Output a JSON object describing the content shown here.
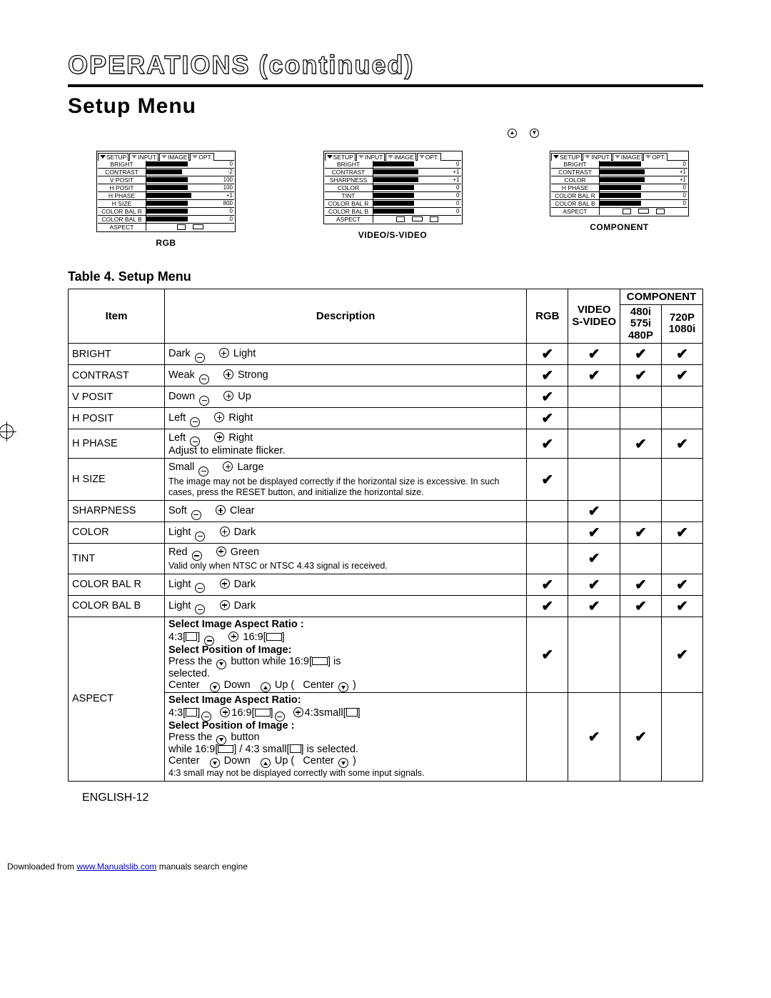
{
  "title": "OPERATIONS (continued)",
  "subtitle": "Setup Menu",
  "panels": {
    "rgb": {
      "caption": "RGB",
      "tabs": [
        "SETUP",
        "INPUT",
        "IMAGE",
        "OPT."
      ],
      "rows": [
        {
          "label": "BRIGHT",
          "bar": 55,
          "val": "0"
        },
        {
          "label": "CONTRAST",
          "bar": 48,
          "val": "-2"
        },
        {
          "label": "V POSIT",
          "bar": 55,
          "val": "100"
        },
        {
          "label": "H POSIT",
          "bar": 55,
          "val": "100"
        },
        {
          "label": "H PHASE",
          "bar": 60,
          "val": "+1"
        },
        {
          "label": "H SIZE",
          "bar": 55,
          "val": "800"
        },
        {
          "label": "COLOR BAL R",
          "bar": 55,
          "val": "0"
        },
        {
          "label": "COLOR BAL B",
          "bar": 55,
          "val": "0"
        }
      ],
      "aspect": "ASPECT"
    },
    "video": {
      "caption": "VIDEO/S-VIDEO",
      "tabs": [
        "SETUP",
        "INPUT",
        "IMAGE",
        "OPT."
      ],
      "rows": [
        {
          "label": "BRIGHT",
          "bar": 55,
          "val": "0"
        },
        {
          "label": "CONTRAST",
          "bar": 60,
          "val": "+1"
        },
        {
          "label": "SHARPNESS",
          "bar": 60,
          "val": "+1"
        },
        {
          "label": "COLOR",
          "bar": 55,
          "val": "0"
        },
        {
          "label": "TINT",
          "bar": 55,
          "val": "0"
        },
        {
          "label": "COLOR BAL R",
          "bar": 55,
          "val": "0"
        },
        {
          "label": "COLOR BAL B",
          "bar": 55,
          "val": "0"
        }
      ],
      "aspect": "ASPECT"
    },
    "component": {
      "caption": "COMPONENT",
      "tabs": [
        "SETUP",
        "INPUT",
        "IMAGE",
        "OPT."
      ],
      "rows": [
        {
          "label": "BRIGHT",
          "bar": 55,
          "val": "0"
        },
        {
          "label": "CONTRAST",
          "bar": 60,
          "val": "+1"
        },
        {
          "label": "COLOR",
          "bar": 60,
          "val": "+1"
        },
        {
          "label": "H PHASE",
          "bar": 55,
          "val": "0"
        },
        {
          "label": "COLOR BAL R",
          "bar": 55,
          "val": "0"
        },
        {
          "label": "COLOR BAL B",
          "bar": 55,
          "val": "0"
        }
      ],
      "aspect": "ASPECT"
    }
  },
  "table_title": "Table 4. Setup Menu",
  "heads": {
    "item": "Item",
    "desc": "Description",
    "rgb": "RGB",
    "video": "VIDEO\nS-VIDEO",
    "component": "COMPONENT",
    "comp480": "480i\n575i\n480P",
    "comp720": "720P\n1080i"
  },
  "rows": {
    "bright": {
      "item": "BRIGHT",
      "l": "Dark",
      "r": "Light",
      "c1": "✔",
      "c2": "✔",
      "c3": "✔",
      "c4": "✔"
    },
    "contrast": {
      "item": "CONTRAST",
      "l": "Weak",
      "r": "Strong",
      "c1": "✔",
      "c2": "✔",
      "c3": "✔",
      "c4": "✔"
    },
    "vposit": {
      "item": "V POSIT",
      "l": "Down",
      "r": "Up",
      "c1": "✔",
      "c2": "",
      "c3": "",
      "c4": ""
    },
    "hposit": {
      "item": "H POSIT",
      "l": "Left",
      "r": "Right",
      "c1": "✔",
      "c2": "",
      "c3": "",
      "c4": ""
    },
    "hphase": {
      "item": "H PHASE",
      "l": "Left",
      "r": "Right",
      "note": "Adjust to eliminate flicker.",
      "c1": "✔",
      "c2": "",
      "c3": "✔",
      "c4": "✔"
    },
    "hsize": {
      "item": "H SIZE",
      "l": "Small",
      "r": "Large",
      "note": "The image may not be displayed correctly if the horizontal size is excessive. In such cases, press the RESET button, and initialize the horizontal size.",
      "c1": "✔",
      "c2": "",
      "c3": "",
      "c4": ""
    },
    "sharp": {
      "item": "SHARPNESS",
      "l": "Soft",
      "r": "Clear",
      "c1": "",
      "c2": "✔",
      "c3": "",
      "c4": ""
    },
    "color": {
      "item": "COLOR",
      "l": "Light",
      "r": "Dark",
      "c1": "",
      "c2": "✔",
      "c3": "✔",
      "c4": "✔"
    },
    "tint": {
      "item": "TINT",
      "l": "Red",
      "r": "Green",
      "note": "Valid only when NTSC or NTSC 4.43 signal is received.",
      "c1": "",
      "c2": "✔",
      "c3": "",
      "c4": ""
    },
    "cbalr": {
      "item": "COLOR BAL R",
      "l": "Light",
      "r": "Dark",
      "c1": "✔",
      "c2": "✔",
      "c3": "✔",
      "c4": "✔"
    },
    "cbalb": {
      "item": "COLOR BAL B",
      "l": "Light",
      "r": "Dark",
      "c1": "✔",
      "c2": "✔",
      "c3": "✔",
      "c4": "✔"
    },
    "aspect": {
      "item": "ASPECT",
      "sel_ratio": "Select Image Aspect Ratio :",
      "sel_ratio2": "Select Image Aspect Ratio:",
      "a43": "4:3[",
      "a169": "16:9[",
      "asmall": "4:3small[",
      "sel_pos": "Select Position of Image:",
      "sel_pos2": "Select Position of Image :",
      "press": "Press the",
      "while169": "button while 16:9[",
      "issel": "] is",
      "selected": "selected.",
      "center": "Center",
      "down": "Down",
      "up": "Up (",
      "center2": "Center",
      "close": ")",
      "press2": "Press the",
      "button": "button",
      "while2": "while 16:9[",
      "slash": "] / 4:3 small[",
      "issel2": "] is selected.",
      "smallnote": "4:3 small may not be displayed correctly with some input signals.",
      "c1a": "✔",
      "c4a": "✔",
      "c2b": "✔",
      "c3b": "✔"
    }
  },
  "page_num": "ENGLISH-12",
  "footer": {
    "pre": "Downloaded from ",
    "link": "www.Manualslib.com",
    "post": " manuals search engine"
  }
}
